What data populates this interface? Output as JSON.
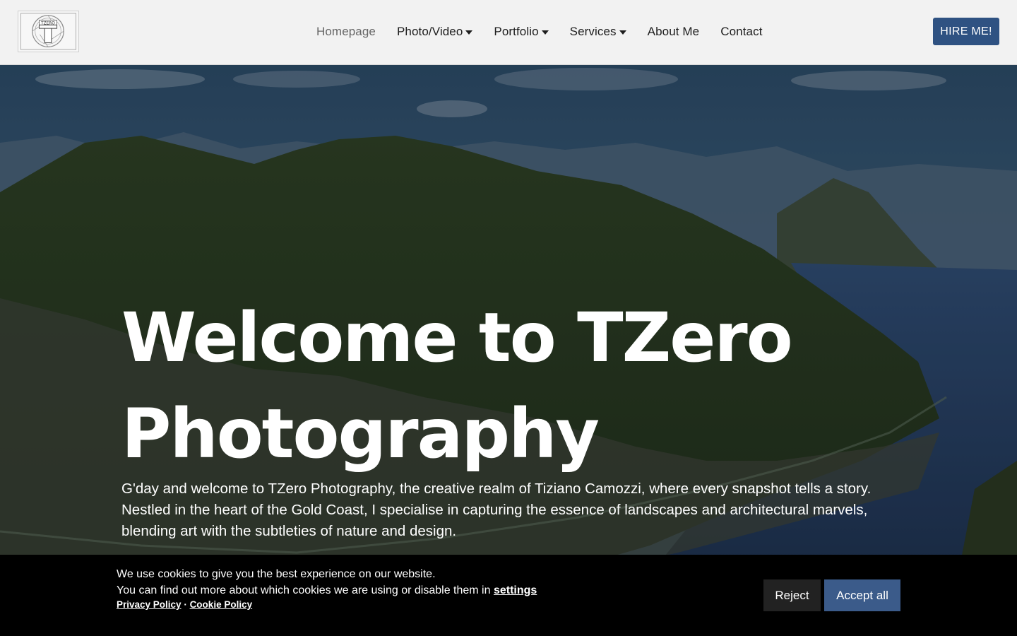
{
  "header": {
    "logo_text": "TZERO",
    "nav": [
      {
        "label": "Homepage",
        "dropdown": false,
        "active": true
      },
      {
        "label": "Photo/Video",
        "dropdown": true,
        "active": false
      },
      {
        "label": "Portfolio",
        "dropdown": true,
        "active": false
      },
      {
        "label": "Services",
        "dropdown": true,
        "active": false
      },
      {
        "label": "About Me",
        "dropdown": false,
        "active": false
      },
      {
        "label": "Contact",
        "dropdown": false,
        "active": false
      }
    ],
    "hire_label": "HIRE ME!"
  },
  "hero": {
    "title_line1": "Welcome to TZero",
    "title_line2": "Photography",
    "intro": "G'day and welcome to TZero Photography, the creative realm of Tiziano Camozzi, where every snapshot tells a story. Nestled in the heart of the Gold Coast, I specialise in capturing the essence of landscapes and architectural marvels, blending art with the subtleties of nature and design."
  },
  "cookie": {
    "line1": "We use cookies to give you the best experience on our website.",
    "line2_prefix": "You can find out more about which cookies we are using or disable them in ",
    "settings_link": "settings",
    "privacy_link": "Privacy Policy",
    "separator": " · ",
    "cookie_link": "Cookie Policy",
    "reject_label": "Reject",
    "accept_label": "Accept all"
  },
  "colors": {
    "header_bg": "#f2f2f2",
    "brand_blue": "#2f5282",
    "accept_blue": "#3b5b8a",
    "cookie_bg": "#000000"
  }
}
